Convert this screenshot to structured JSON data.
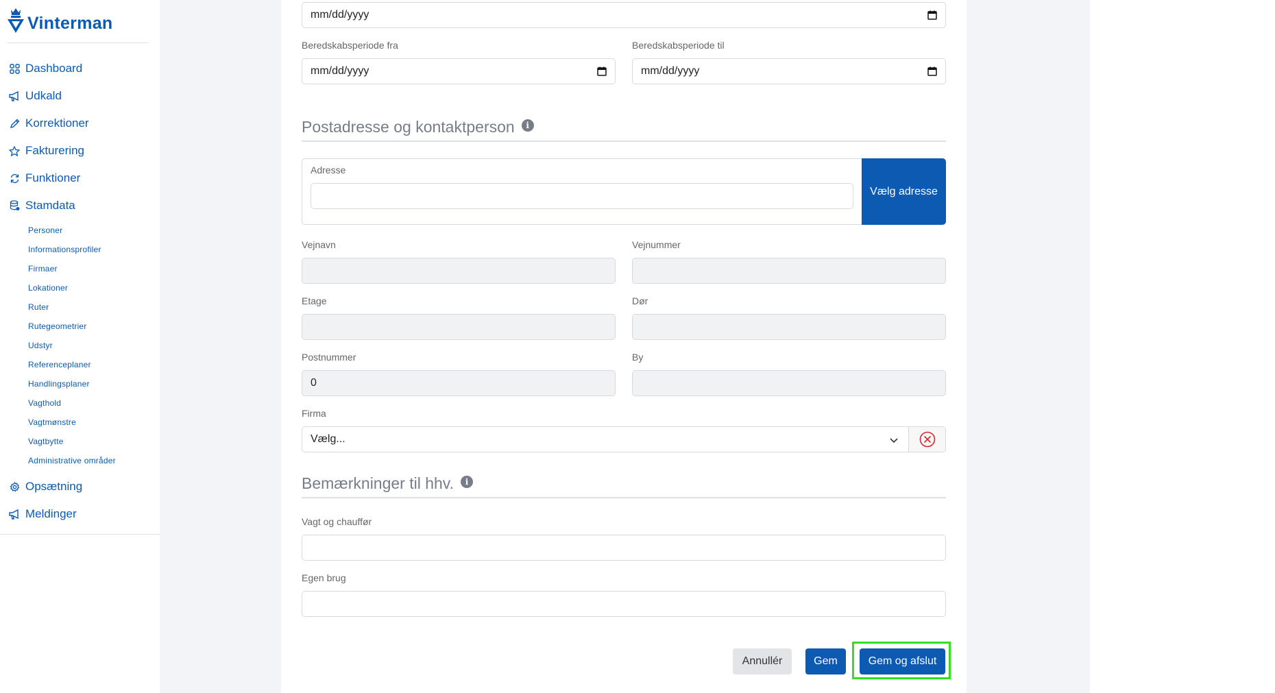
{
  "app": {
    "brand": "Vinterman"
  },
  "sidebar": {
    "items": [
      {
        "label": "Dashboard",
        "icon": "grid-icon"
      },
      {
        "label": "Udkald",
        "icon": "megaphone-icon"
      },
      {
        "label": "Korrektioner",
        "icon": "pencil-icon"
      },
      {
        "label": "Fakturering",
        "icon": "star-icon"
      },
      {
        "label": "Funktioner",
        "icon": "refresh-icon"
      },
      {
        "label": "Stamdata",
        "icon": "database-icon"
      }
    ],
    "stamdata_sub": [
      "Personer",
      "Informationsprofiler",
      "Firmaer",
      "Lokationer",
      "Ruter",
      "Rutegeometrier",
      "Udstyr",
      "Referenceplaner",
      "Handlingsplaner",
      "Vagthold",
      "Vagtmønstre",
      "Vagtbytte",
      "Administrative områder"
    ],
    "bottom_items": [
      {
        "label": "Opsætning",
        "icon": "gear-icon"
      },
      {
        "label": "Meldinger",
        "icon": "megaphone-icon"
      }
    ]
  },
  "form": {
    "top_date": {
      "value": "mm/dd/yyyy"
    },
    "beredskab_fra": {
      "label": "Beredskabsperiode fra",
      "value": "mm/dd/yyyy"
    },
    "beredskab_til": {
      "label": "Beredskabsperiode til",
      "value": "mm/dd/yyyy"
    },
    "section_post": {
      "title": "Postadresse og kontaktperson"
    },
    "adresse": {
      "label": "Adresse",
      "value": "",
      "button": "Vælg adresse"
    },
    "vejnavn": {
      "label": "Vejnavn",
      "value": ""
    },
    "vejnummer": {
      "label": "Vejnummer",
      "value": ""
    },
    "etage": {
      "label": "Etage",
      "value": ""
    },
    "dor": {
      "label": "Dør",
      "value": ""
    },
    "postnummer": {
      "label": "Postnummer",
      "value": "0"
    },
    "by": {
      "label": "By",
      "value": ""
    },
    "firma": {
      "label": "Firma",
      "value": "Vælg..."
    },
    "section_bem": {
      "title": "Bemærkninger til hhv."
    },
    "vagt": {
      "label": "Vagt og chauffør",
      "value": ""
    },
    "egen": {
      "label": "Egen brug",
      "value": ""
    }
  },
  "actions": {
    "cancel": "Annullér",
    "save": "Gem",
    "save_close": "Gem og afslut"
  },
  "colors": {
    "brand": "#0c5ab1",
    "highlight": "#33e01e",
    "danger": "#d9262c"
  }
}
